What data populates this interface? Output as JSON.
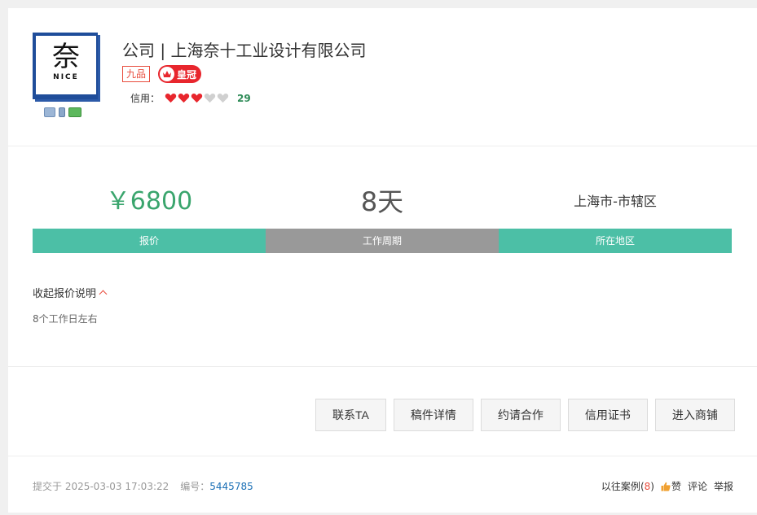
{
  "shop": {
    "name": "公司 | 上海奈十工业设计有限公司",
    "logo_glyph": "奈",
    "logo_text": "NICE",
    "level": "九品",
    "crown_label": "皇冠",
    "credit_label": "信用：",
    "credit_hearts_filled": 3,
    "credit_hearts_total": 5,
    "credit_score": "29",
    "verify_icons": [
      "id-card-icon",
      "phone-icon",
      "bank-card-icon"
    ]
  },
  "stats": {
    "price": "￥6800",
    "period": "8天",
    "region": "上海市-市辖区",
    "price_label": "报价",
    "period_label": "工作周期",
    "region_label": "所在地区"
  },
  "explain": {
    "toggle_label": "收起报价说明",
    "text": "8个工作日左右"
  },
  "actions": [
    "联系TA",
    "稿件详情",
    "约请合作",
    "信用证书",
    "进入商铺"
  ],
  "footer": {
    "submitted_label": "提交于 2025-03-03 17:03:22",
    "id_label": "编号：",
    "id_value": "5445785",
    "cases_label": "以往案例",
    "cases_open": "(",
    "cases_count": "8",
    "cases_close": ")",
    "like_label": "赞",
    "comment_label": "评论",
    "report_label": "举报"
  },
  "colors": {
    "accent_green": "#4cbfa6",
    "price_green": "#3aa56d",
    "gray_bar": "#999999",
    "red": "#e84c3d"
  }
}
